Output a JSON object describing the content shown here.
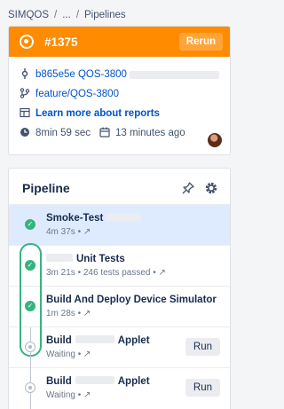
{
  "breadcrumb": {
    "items": [
      "SIMQOS",
      "...",
      "Pipelines"
    ],
    "separator": "/"
  },
  "build": {
    "number": "#1375",
    "status_color": "#ff8b00",
    "rerun_label": "Rerun",
    "commit": "b865e5e QOS-3800",
    "branch": "feature/QOS-3800",
    "learn_more": "Learn more about reports",
    "duration": "8min 59 sec",
    "time_ago": "13 minutes ago"
  },
  "pipeline": {
    "title": "Pipeline",
    "steps": [
      {
        "name": "Smoke-Test",
        "meta": "4m 37s",
        "status": "success",
        "active": true
      },
      {
        "name": "Unit Tests",
        "meta": "3m 21s",
        "extra": "246 tests passed",
        "status": "success"
      },
      {
        "name": "Build And Deploy Device Simulator",
        "meta": "1m 28s",
        "status": "success"
      },
      {
        "name": "Build",
        "name_suffix": "Applet",
        "meta": "Waiting",
        "status": "waiting",
        "run_label": "Run"
      },
      {
        "name": "Build",
        "name_suffix": "Applet",
        "meta": "Waiting",
        "status": "waiting",
        "run_label": "Run"
      }
    ]
  },
  "colors": {
    "accent": "#0052cc",
    "success": "#36b37e",
    "active_row": "#deebff"
  }
}
